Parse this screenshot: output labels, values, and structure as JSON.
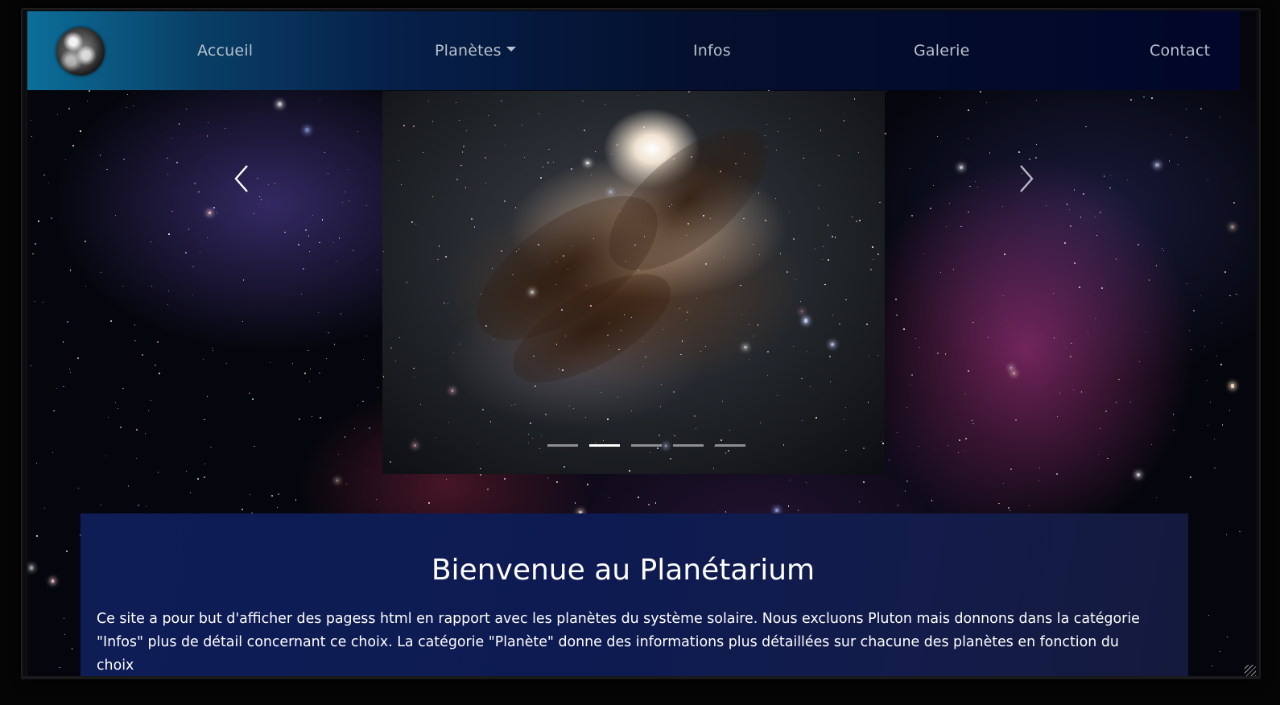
{
  "nav": {
    "logo": "earth-logo",
    "items": [
      {
        "label": "Accueil"
      },
      {
        "label": "Planètes",
        "dropdown": true
      },
      {
        "label": "Infos"
      },
      {
        "label": "Galerie"
      },
      {
        "label": "Contact"
      }
    ]
  },
  "carousel": {
    "prev_icon": "chevron-left-icon",
    "next_icon": "chevron-right-icon",
    "slide_count": 5,
    "active_index": 1
  },
  "welcome": {
    "title": "Bienvenue au Planétarium",
    "text": "Ce site a pour but d'afficher des pagess html en rapport avec les planètes du système solaire. Nous excluons Pluton mais donnons dans la catégorie \"Infos\" plus de détail concernant ce choix. La catégorie \"Planète\" donne des informations plus détaillées sur chacune des planètes en fonction du choix"
  },
  "colors": {
    "nav_gradient_start": "#0c6f9a",
    "nav_gradient_end": "#02062a",
    "panel_bg": "#0f1d57",
    "nav_text": "#b9c2cc"
  }
}
